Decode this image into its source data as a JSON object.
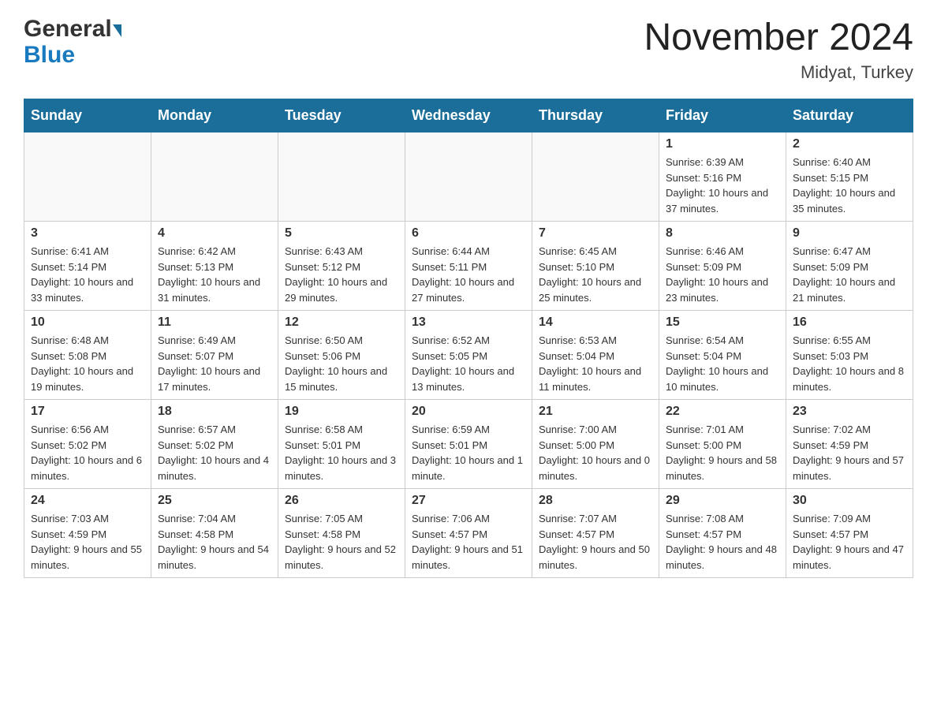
{
  "header": {
    "logo_line1": "General",
    "logo_line2": "Blue",
    "title": "November 2024",
    "subtitle": "Midyat, Turkey"
  },
  "days_of_week": [
    "Sunday",
    "Monday",
    "Tuesday",
    "Wednesday",
    "Thursday",
    "Friday",
    "Saturday"
  ],
  "weeks": [
    [
      {
        "num": "",
        "info": ""
      },
      {
        "num": "",
        "info": ""
      },
      {
        "num": "",
        "info": ""
      },
      {
        "num": "",
        "info": ""
      },
      {
        "num": "",
        "info": ""
      },
      {
        "num": "1",
        "info": "Sunrise: 6:39 AM\nSunset: 5:16 PM\nDaylight: 10 hours and 37 minutes."
      },
      {
        "num": "2",
        "info": "Sunrise: 6:40 AM\nSunset: 5:15 PM\nDaylight: 10 hours and 35 minutes."
      }
    ],
    [
      {
        "num": "3",
        "info": "Sunrise: 6:41 AM\nSunset: 5:14 PM\nDaylight: 10 hours and 33 minutes."
      },
      {
        "num": "4",
        "info": "Sunrise: 6:42 AM\nSunset: 5:13 PM\nDaylight: 10 hours and 31 minutes."
      },
      {
        "num": "5",
        "info": "Sunrise: 6:43 AM\nSunset: 5:12 PM\nDaylight: 10 hours and 29 minutes."
      },
      {
        "num": "6",
        "info": "Sunrise: 6:44 AM\nSunset: 5:11 PM\nDaylight: 10 hours and 27 minutes."
      },
      {
        "num": "7",
        "info": "Sunrise: 6:45 AM\nSunset: 5:10 PM\nDaylight: 10 hours and 25 minutes."
      },
      {
        "num": "8",
        "info": "Sunrise: 6:46 AM\nSunset: 5:09 PM\nDaylight: 10 hours and 23 minutes."
      },
      {
        "num": "9",
        "info": "Sunrise: 6:47 AM\nSunset: 5:09 PM\nDaylight: 10 hours and 21 minutes."
      }
    ],
    [
      {
        "num": "10",
        "info": "Sunrise: 6:48 AM\nSunset: 5:08 PM\nDaylight: 10 hours and 19 minutes."
      },
      {
        "num": "11",
        "info": "Sunrise: 6:49 AM\nSunset: 5:07 PM\nDaylight: 10 hours and 17 minutes."
      },
      {
        "num": "12",
        "info": "Sunrise: 6:50 AM\nSunset: 5:06 PM\nDaylight: 10 hours and 15 minutes."
      },
      {
        "num": "13",
        "info": "Sunrise: 6:52 AM\nSunset: 5:05 PM\nDaylight: 10 hours and 13 minutes."
      },
      {
        "num": "14",
        "info": "Sunrise: 6:53 AM\nSunset: 5:04 PM\nDaylight: 10 hours and 11 minutes."
      },
      {
        "num": "15",
        "info": "Sunrise: 6:54 AM\nSunset: 5:04 PM\nDaylight: 10 hours and 10 minutes."
      },
      {
        "num": "16",
        "info": "Sunrise: 6:55 AM\nSunset: 5:03 PM\nDaylight: 10 hours and 8 minutes."
      }
    ],
    [
      {
        "num": "17",
        "info": "Sunrise: 6:56 AM\nSunset: 5:02 PM\nDaylight: 10 hours and 6 minutes."
      },
      {
        "num": "18",
        "info": "Sunrise: 6:57 AM\nSunset: 5:02 PM\nDaylight: 10 hours and 4 minutes."
      },
      {
        "num": "19",
        "info": "Sunrise: 6:58 AM\nSunset: 5:01 PM\nDaylight: 10 hours and 3 minutes."
      },
      {
        "num": "20",
        "info": "Sunrise: 6:59 AM\nSunset: 5:01 PM\nDaylight: 10 hours and 1 minute."
      },
      {
        "num": "21",
        "info": "Sunrise: 7:00 AM\nSunset: 5:00 PM\nDaylight: 10 hours and 0 minutes."
      },
      {
        "num": "22",
        "info": "Sunrise: 7:01 AM\nSunset: 5:00 PM\nDaylight: 9 hours and 58 minutes."
      },
      {
        "num": "23",
        "info": "Sunrise: 7:02 AM\nSunset: 4:59 PM\nDaylight: 9 hours and 57 minutes."
      }
    ],
    [
      {
        "num": "24",
        "info": "Sunrise: 7:03 AM\nSunset: 4:59 PM\nDaylight: 9 hours and 55 minutes."
      },
      {
        "num": "25",
        "info": "Sunrise: 7:04 AM\nSunset: 4:58 PM\nDaylight: 9 hours and 54 minutes."
      },
      {
        "num": "26",
        "info": "Sunrise: 7:05 AM\nSunset: 4:58 PM\nDaylight: 9 hours and 52 minutes."
      },
      {
        "num": "27",
        "info": "Sunrise: 7:06 AM\nSunset: 4:57 PM\nDaylight: 9 hours and 51 minutes."
      },
      {
        "num": "28",
        "info": "Sunrise: 7:07 AM\nSunset: 4:57 PM\nDaylight: 9 hours and 50 minutes."
      },
      {
        "num": "29",
        "info": "Sunrise: 7:08 AM\nSunset: 4:57 PM\nDaylight: 9 hours and 48 minutes."
      },
      {
        "num": "30",
        "info": "Sunrise: 7:09 AM\nSunset: 4:57 PM\nDaylight: 9 hours and 47 minutes."
      }
    ]
  ]
}
